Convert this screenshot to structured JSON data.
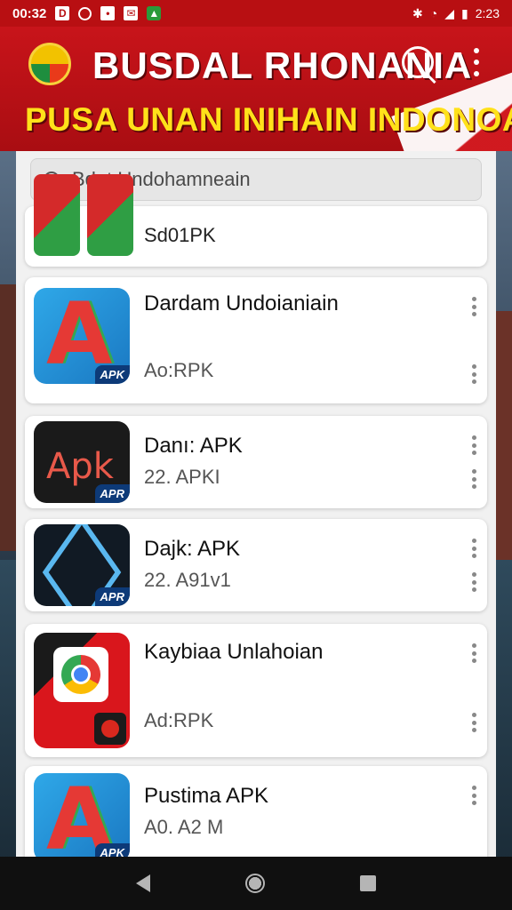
{
  "status_bar": {
    "time": "00:32",
    "battery": "2:23"
  },
  "header": {
    "title": "BUSDAL RHONANIA",
    "subtitle": "PUSA UNAN INIHAIN INDONOAK'S"
  },
  "search": {
    "placeholder": "Bdat Undohamneain"
  },
  "apps": [
    {
      "name": "",
      "sub": "Sd01PK"
    },
    {
      "name": "Dardam Undoianiain",
      "sub": "Ao:RPK"
    },
    {
      "name": "Danı: APK",
      "sub": "22. APKI"
    },
    {
      "name": "Dajk: APK",
      "sub": "22. A91v1"
    },
    {
      "name": "Kaybiaa Unlahoian",
      "sub": "Ad:RPK"
    },
    {
      "name": "Pustima APK",
      "sub": "A0. A2 M"
    }
  ],
  "icon_labels": {
    "apk_word": "Apk",
    "apk_tag": "APK",
    "apk_tag_alt": "APR"
  },
  "colors": {
    "header_red": "#c8141a",
    "subtitle_yellow": "#ffe11a",
    "apk_blue": "#0d3a78"
  },
  "icons": [
    "search-icon",
    "kebab-menu-icon",
    "back-icon",
    "home-icon",
    "recents-icon"
  ]
}
